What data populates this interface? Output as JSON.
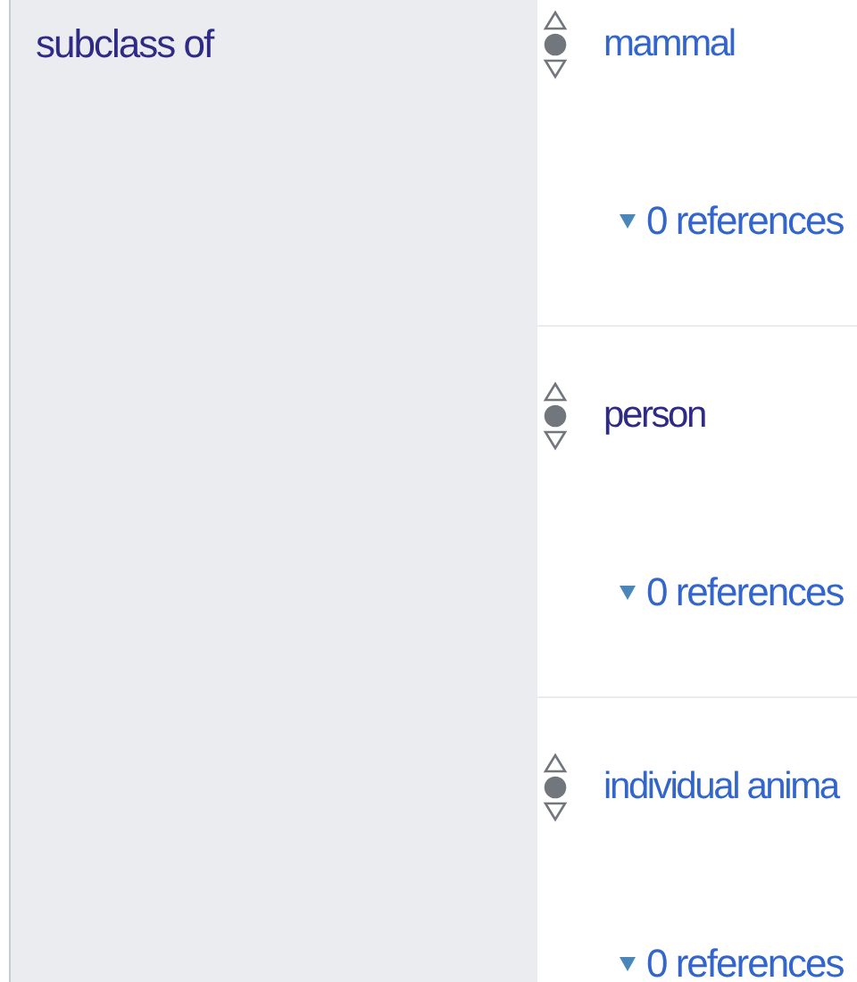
{
  "property": {
    "label": "subclass of",
    "visited": true
  },
  "statements": [
    {
      "value": "mammal",
      "visited": false,
      "rank": {
        "preferred": false,
        "normal": true,
        "deprecated": false
      },
      "references": "0 references"
    },
    {
      "value": "person",
      "visited": true,
      "rank": {
        "preferred": false,
        "normal": true,
        "deprecated": false
      },
      "references": "0 references"
    },
    {
      "value": "individual anima",
      "visited": false,
      "rank": {
        "preferred": false,
        "normal": true,
        "deprecated": false
      },
      "references": "0 references"
    }
  ]
}
